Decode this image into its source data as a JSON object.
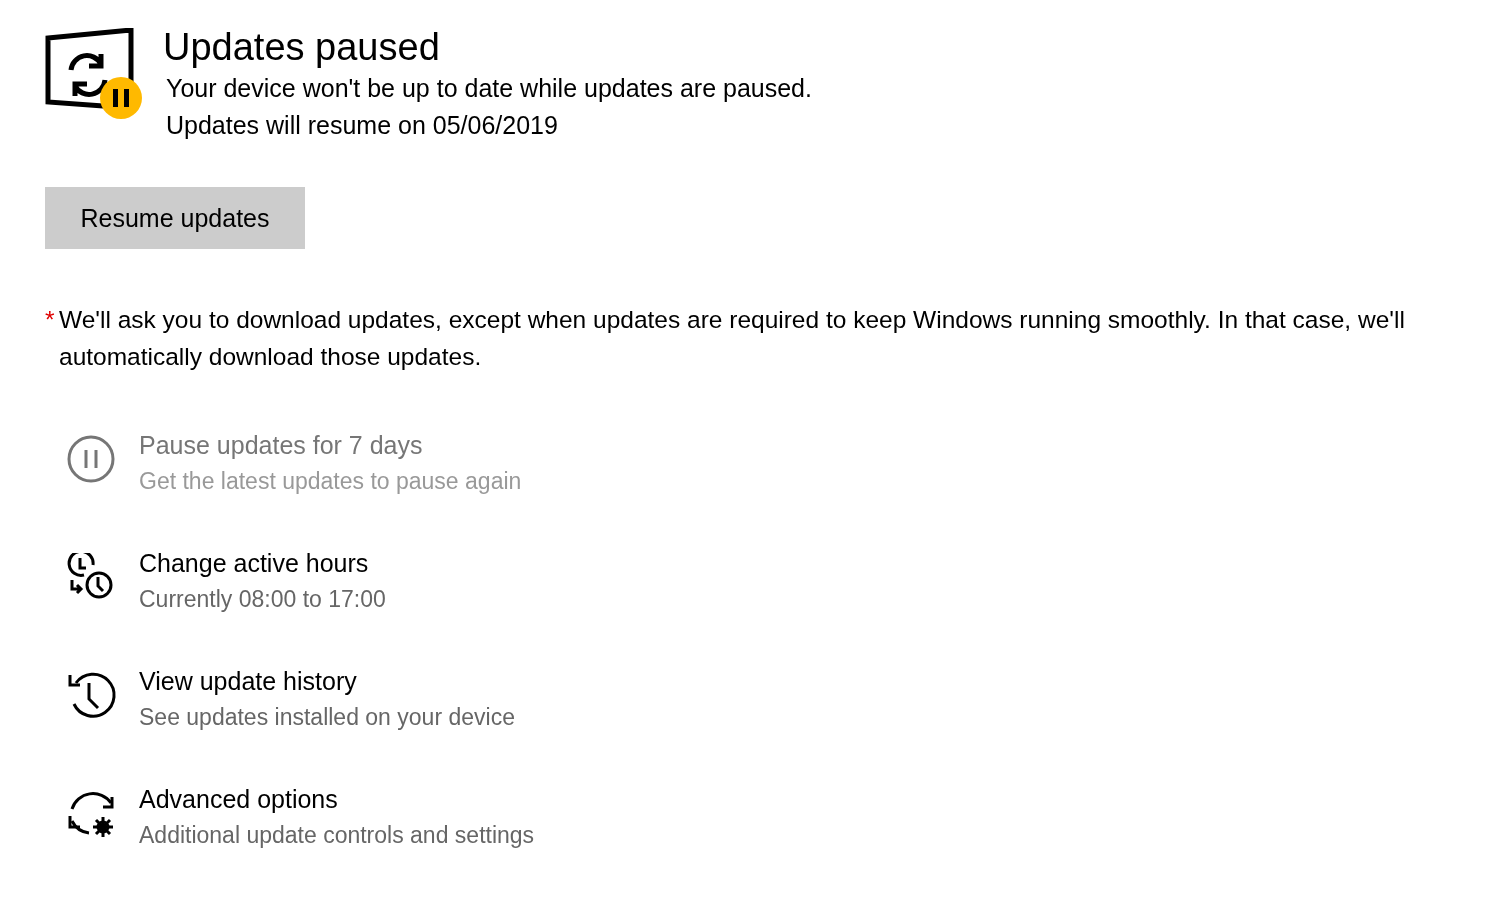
{
  "status": {
    "title": "Updates paused",
    "paused": true,
    "lines": [
      "Your device won't be up to date while updates are paused.",
      "Updates will resume on 05/06/2019"
    ]
  },
  "resume_button": {
    "label": "Resume updates"
  },
  "note": {
    "mark": "*",
    "text": "We'll ask you to download updates, except when updates are required to keep Windows running smoothly. In that case, we'll automatically download those updates."
  },
  "options": [
    {
      "kind": "pause",
      "title": "Pause updates for 7 days",
      "subtitle": "Get the latest updates to pause again",
      "disabled": true
    },
    {
      "kind": "active-hours",
      "title": "Change active hours",
      "subtitle": "Currently 08:00 to 17:00",
      "disabled": false
    },
    {
      "kind": "history",
      "title": "View update history",
      "subtitle": "See updates installed on your device",
      "disabled": false
    },
    {
      "kind": "advanced",
      "title": "Advanced options",
      "subtitle": "Additional update controls and settings",
      "disabled": false
    }
  ]
}
